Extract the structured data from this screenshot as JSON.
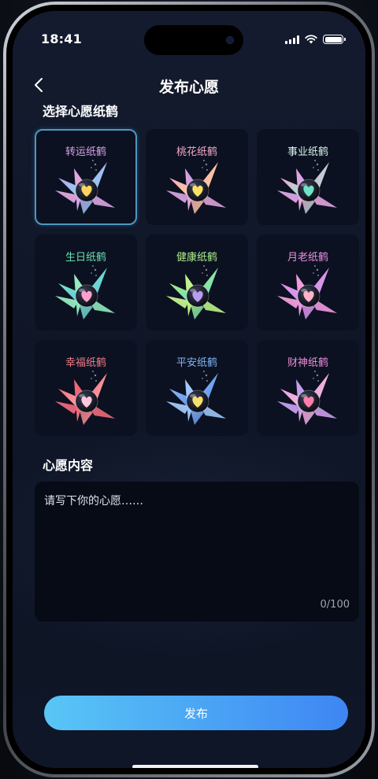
{
  "status": {
    "time": "18:41"
  },
  "nav": {
    "title": "发布心愿"
  },
  "crane_section": {
    "title": "选择心愿纸鹤"
  },
  "cranes": [
    {
      "label": "转运纸鹤",
      "label_color": "#d9a2e9",
      "a": "#c7a6f0",
      "b": "#7fd2f2",
      "c": "#f3a7cf",
      "heart": "#ffd45e",
      "selected": true
    },
    {
      "label": "桃花纸鹤",
      "label_color": "#f3a9c9",
      "a": "#f7a6c8",
      "b": "#ffd28a",
      "c": "#b79bf0",
      "heart": "#ffe066",
      "selected": false
    },
    {
      "label": "事业纸鹤",
      "label_color": "#d8f0ec",
      "a": "#f6a3d1",
      "b": "#9fe6d3",
      "c": "#c5a7f5",
      "heart": "#6fe2c8",
      "selected": false
    },
    {
      "label": "生日纸鹤",
      "label_color": "#69e0b0",
      "a": "#7fe3b7",
      "b": "#5fc8e8",
      "c": "#a7f0c6",
      "heart": "#ff9fce",
      "selected": false
    },
    {
      "label": "健康纸鹤",
      "label_color": "#aef08c",
      "a": "#a9ef7a",
      "b": "#6fdcc4",
      "c": "#d6f29a",
      "heart": "#b79cf3",
      "selected": false
    },
    {
      "label": "月老纸鹤",
      "label_color": "#ec8fe4",
      "a": "#ee8ee6",
      "b": "#c69af0",
      "c": "#f6a8d6",
      "heart": "#ffb3c7",
      "selected": false
    },
    {
      "label": "幸福纸鹤",
      "label_color": "#f27b8a",
      "a": "#f2727f",
      "b": "#ff9fa8",
      "c": "#ec5c74",
      "heart": "#ffc8da",
      "selected": false
    },
    {
      "label": "平安纸鹤",
      "label_color": "#7fb4f4",
      "a": "#8bbcf5",
      "b": "#5f8ff0",
      "c": "#b4d3fb",
      "heart": "#f6e06c",
      "selected": false
    },
    {
      "label": "财神纸鹤",
      "label_color": "#ea8fd6",
      "a": "#e7a0e6",
      "b": "#f3b9d8",
      "c": "#a89cf2",
      "heart": "#ff7fa8",
      "selected": false
    }
  ],
  "wish_section": {
    "title": "心愿内容"
  },
  "wish": {
    "placeholder": "请写下你的心愿……",
    "value": "",
    "counter": "0/100"
  },
  "publish": {
    "label": "发布"
  },
  "colors": {
    "accent_start": "#59c6f6",
    "accent_end": "#3e86f3",
    "selected_border": "#4d97c2"
  }
}
